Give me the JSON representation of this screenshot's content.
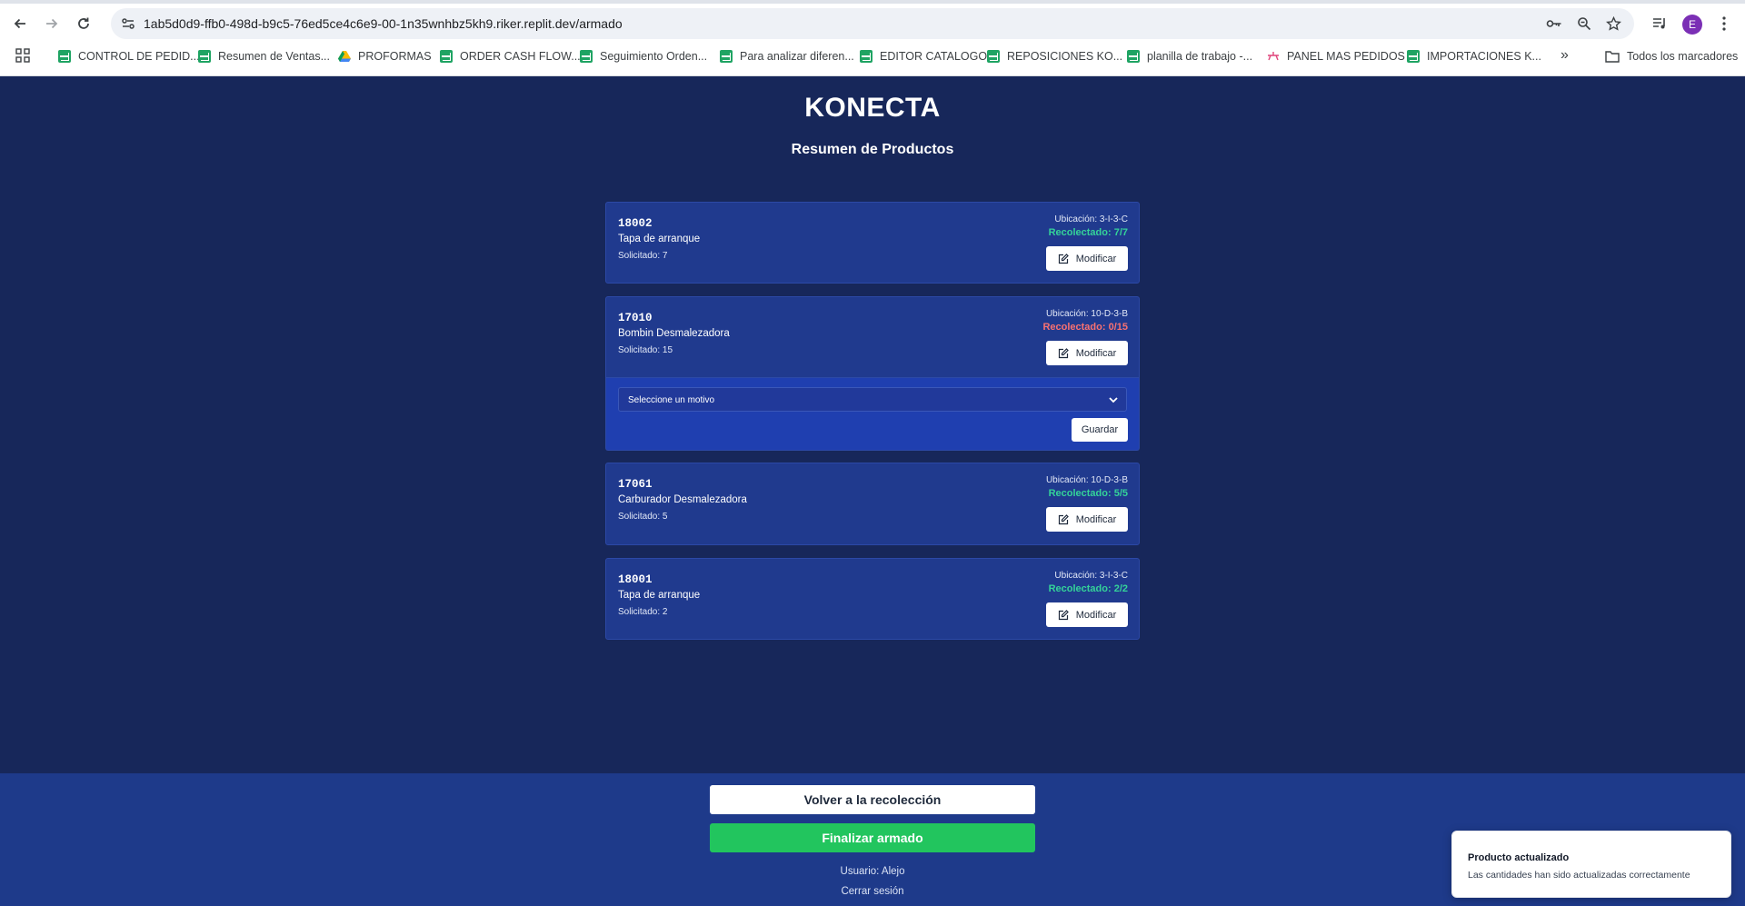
{
  "browser": {
    "url": "1ab5d0d9-ffb0-498d-b9c5-76ed5ce4c6e9-00-1n35wnhbz5kh9.riker.replit.dev/armado",
    "avatar_letter": "E",
    "avatar_color": "#7b2fb5",
    "bookmarks": [
      {
        "label": "CONTROL DE PEDID...",
        "icon": "sheets-icon"
      },
      {
        "label": "Resumen de Ventas...",
        "icon": "sheets-icon"
      },
      {
        "label": "PROFORMAS",
        "icon": "drive-icon"
      },
      {
        "label": "ORDER CASH FLOW...",
        "icon": "sheets-icon"
      },
      {
        "label": "Seguimiento Orden...",
        "icon": "sheets-icon"
      },
      {
        "label": "Para analizar diferen...",
        "icon": "sheets-icon"
      },
      {
        "label": "EDITOR CATALOGO",
        "icon": "sheets-icon"
      },
      {
        "label": "REPOSICIONES KO...",
        "icon": "sheets-icon"
      },
      {
        "label": "planilla de trabajo -...",
        "icon": "sheets-icon"
      },
      {
        "label": "PANEL MAS PEDIDOS",
        "icon": "app-icon"
      },
      {
        "label": "IMPORTACIONES K...",
        "icon": "sheets-icon"
      }
    ],
    "all_bookmarks_label": "Todos los marcadores"
  },
  "app": {
    "title": "KONECTA",
    "subtitle": "Resumen de Productos"
  },
  "products": [
    {
      "code": "18002",
      "name": "Tapa de arranque",
      "requested": "Solicitado: 7",
      "location": "Ubicación: 3-I-3-C",
      "collected": "Recolectado: 7/7",
      "status": "complete",
      "button": "Modificar"
    },
    {
      "code": "17010",
      "name": "Bombin Desmalezadora",
      "requested": "Solicitado: 15",
      "location": "Ubicación: 10-D-3-B",
      "collected": "Recolectado: 0/15",
      "status": "incomplete",
      "button": "Modificar"
    },
    {
      "code": "17061",
      "name": "Carburador Desmalezadora",
      "requested": "Solicitado: 5",
      "location": "Ubicación: 10-D-3-B",
      "collected": "Recolectado: 5/5",
      "status": "complete",
      "button": "Modificar"
    },
    {
      "code": "18001",
      "name": "Tapa de arranque",
      "requested": "Solicitado: 2",
      "location": "Ubicación: 3-I-3-C",
      "collected": "Recolectado: 2/2",
      "status": "complete",
      "button": "Modificar"
    }
  ],
  "reason": {
    "placeholder": "Seleccione un motivo",
    "save_label": "Guardar"
  },
  "footer": {
    "back_label": "Volver a la recolección",
    "finish_label": "Finalizar armado",
    "user_line": "Usuario: Alejo",
    "logout_label": "Cerrar sesión"
  },
  "toast": {
    "title": "Producto actualizado",
    "description": "Las cantidades han sido actualizadas correctamente"
  },
  "colors": {
    "background": "#17275a",
    "card": "#203a8e",
    "complete": "#34d399",
    "incomplete": "#f87171",
    "finish_button": "#22c55e"
  }
}
